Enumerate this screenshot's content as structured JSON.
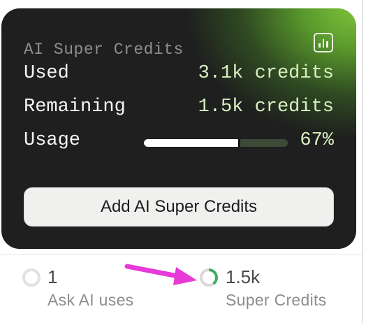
{
  "card": {
    "title": "AI Super Credits",
    "chart_icon": "bar-chart-icon",
    "used_label": "Used",
    "used_value": "3.1k credits",
    "remaining_label": "Remaining",
    "remaining_value": "1.5k credits",
    "usage_label": "Usage",
    "usage_percent_text": "67%",
    "usage_fraction": 0.67,
    "add_button_label": "Add AI Super Credits"
  },
  "stats": [
    {
      "value": "1",
      "caption": "Ask AI uses",
      "icon": "empty-ring-icon"
    },
    {
      "value": "1.5k",
      "caption": "Super Credits",
      "icon": "progress-ring-icon"
    }
  ],
  "colors": {
    "accent_green": "#7fc23a",
    "ring_green": "#3fae5a",
    "annotation_arrow": "#e83ad8"
  }
}
